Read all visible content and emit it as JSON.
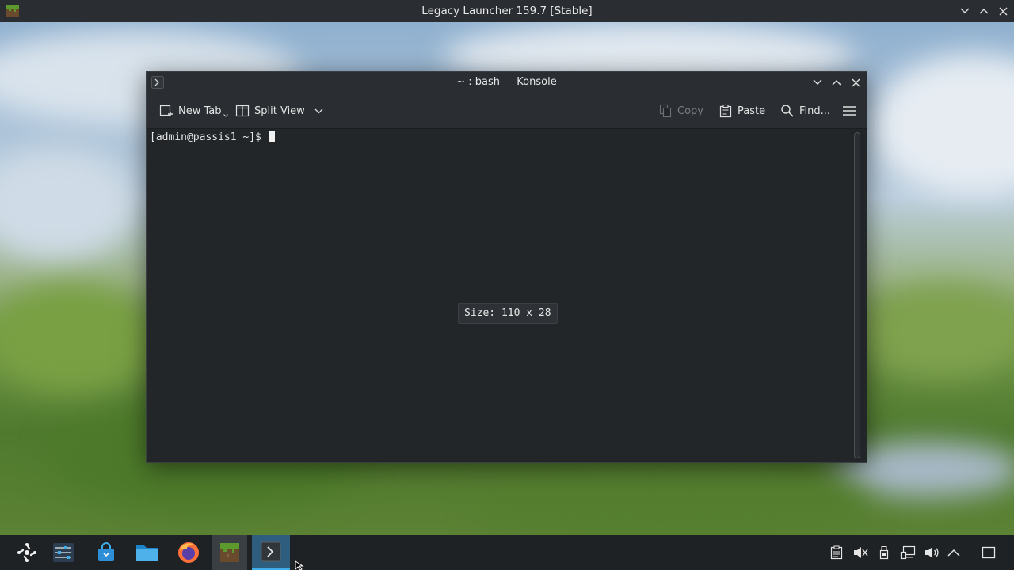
{
  "topbar": {
    "title": "Legacy Launcher 159.7 [Stable]",
    "icon": "minecraft-grass-block-icon"
  },
  "konsole": {
    "title": "~ : bash — Konsole",
    "toolbar": {
      "new_tab": "New Tab",
      "split_view": "Split View",
      "copy": "Copy",
      "paste": "Paste",
      "find": "Find...",
      "menu_icon": "hamburger-menu-icon"
    },
    "terminal": {
      "prompt": "[admin@passis1 ~]$ ",
      "size_overlay": "Size: 110 x 28"
    }
  },
  "taskbar": {
    "items": [
      {
        "name": "application-launcher",
        "icon": "kde-launcher-icon"
      },
      {
        "name": "system-settings",
        "icon": "settings-sliders-icon"
      },
      {
        "name": "discover",
        "icon": "store-bag-icon"
      },
      {
        "name": "dolphin",
        "icon": "folder-icon"
      },
      {
        "name": "firefox",
        "icon": "firefox-icon"
      },
      {
        "name": "legacy-launcher",
        "icon": "minecraft-grass-block-icon"
      },
      {
        "name": "konsole",
        "icon": "terminal-prompt-icon"
      }
    ],
    "tray": [
      "clipboard-icon",
      "volume-muted-icon",
      "usb-device-icon",
      "network-icon",
      "volume-icon",
      "tray-expand-icon",
      "show-desktop-icon"
    ]
  },
  "colors": {
    "accent": "#3daee9",
    "window_bg": "#232629",
    "titlebar_bg": "#2a2e32",
    "taskbar_bg": "#1f2225"
  }
}
